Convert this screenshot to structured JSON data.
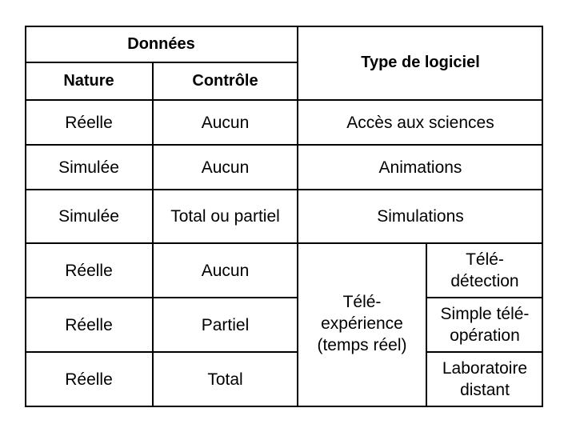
{
  "table": {
    "header": {
      "group_label": "Données",
      "col_nature": "Nature",
      "col_controle": "Contrôle",
      "col_type": "Type de logiciel"
    },
    "rows": [
      {
        "nature": "Réelle",
        "controle": "Aucun",
        "type": "Accès aux sciences"
      },
      {
        "nature": "Simulée",
        "controle": "Aucun",
        "type": "Animations"
      },
      {
        "nature": "Simulée",
        "controle": "Total ou partiel",
        "type": "Simulations"
      },
      {
        "nature": "Réelle",
        "controle": "Aucun",
        "subtype": "Télé-\ndétection"
      },
      {
        "nature": "Réelle",
        "controle": "Partiel",
        "subtype": "Simple télé-\nopération"
      },
      {
        "nature": "Réelle",
        "controle": "Total",
        "subtype": "Laboratoire\ndistant"
      }
    ],
    "grouped_type": "Télé-\nexpérience\n(temps réel)"
  }
}
